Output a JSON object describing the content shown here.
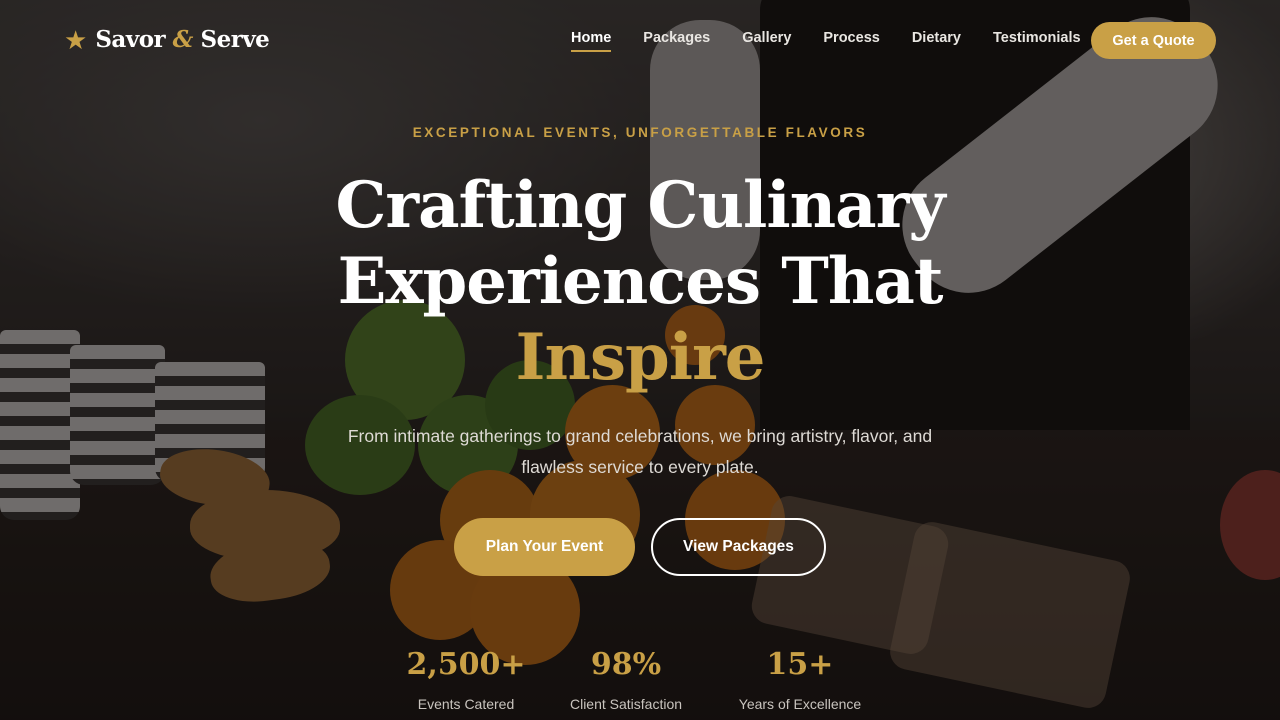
{
  "brand": {
    "name_part1": "Savor",
    "amp": "&",
    "name_part2": "Serve",
    "star": "★"
  },
  "nav": {
    "items": [
      {
        "label": "Home",
        "active": true
      },
      {
        "label": "Packages"
      },
      {
        "label": "Gallery"
      },
      {
        "label": "Process"
      },
      {
        "label": "Dietary"
      },
      {
        "label": "Testimonials"
      }
    ],
    "cta_label": "Get a Quote"
  },
  "hero": {
    "eyebrow": "EXCEPTIONAL EVENTS, UNFORGETTABLE FLAVORS",
    "headline_line1": "Crafting Culinary",
    "headline_line2": "Experiences That",
    "headline_accent": "Inspire",
    "subtitle": "From intimate gatherings to grand celebrations, we bring artistry, flavor, and flawless service to every plate.",
    "primary_button": "Plan Your Event",
    "secondary_button": "View Packages"
  },
  "stats": [
    {
      "value": "2,500+",
      "label": "Events Catered"
    },
    {
      "value": "98%",
      "label": "Client Satisfaction"
    },
    {
      "value": "15+",
      "label": "Years of Excellence"
    }
  ],
  "colors": {
    "accent": "#c9a046",
    "text": "#ffffff",
    "overlay": "#0c0a09"
  }
}
